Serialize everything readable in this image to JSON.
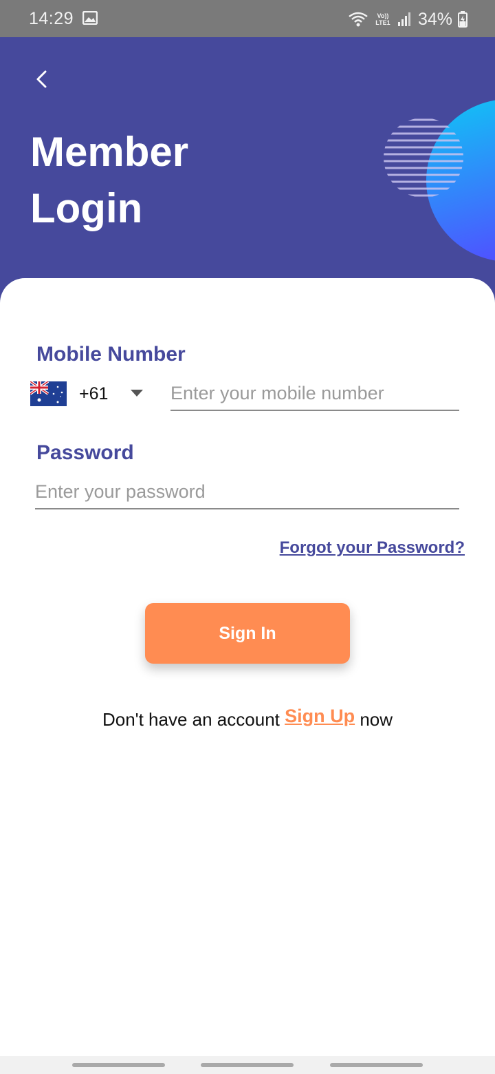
{
  "status_bar": {
    "time": "14:29",
    "network_label": "Vo)) LTE1",
    "battery": "34%",
    "icons": [
      "image-icon",
      "wifi-icon",
      "signal-icon",
      "battery-charging-icon"
    ]
  },
  "header": {
    "back_icon": "chevron-left-icon",
    "title_line1": "Member",
    "title_line2": "Login",
    "colors": {
      "background": "#46499c",
      "circle_gradient_start": "#0fc6f5",
      "circle_gradient_end": "#4d55ff"
    }
  },
  "form": {
    "mobile_label": "Mobile Number",
    "country_flag": "australia-flag-icon",
    "country_code": "+61",
    "mobile_placeholder": "Enter your mobile number",
    "mobile_value": "",
    "password_label": "Password",
    "password_placeholder": "Enter your password",
    "password_value": "",
    "forgot_link": "Forgot your Password?",
    "signin_button": "Sign In",
    "accent_color": "#ff8c52",
    "primary_color": "#46499c"
  },
  "signup": {
    "prefix": "Don't have an account",
    "link": "Sign Up",
    "suffix": "now"
  }
}
